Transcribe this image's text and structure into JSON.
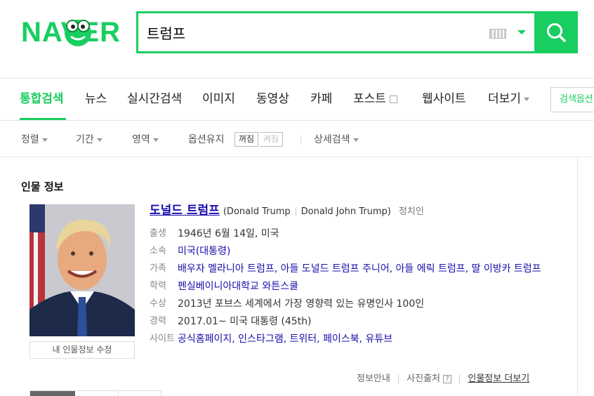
{
  "logo": {
    "text": "NAVER"
  },
  "search": {
    "query": "트럼프"
  },
  "tabs": {
    "items": [
      {
        "label": "통합검색",
        "active": true
      },
      {
        "label": "뉴스"
      },
      {
        "label": "실시간검색"
      },
      {
        "label": "이미지"
      },
      {
        "label": "동영상"
      },
      {
        "label": "카페"
      },
      {
        "label": "포스트"
      },
      {
        "label": "웹사이트"
      },
      {
        "label": "더보기"
      }
    ],
    "options_label": "검색옵션"
  },
  "filters": {
    "sort": "정렬",
    "period": "기간",
    "area": "영역",
    "keep_option": "옵션유지",
    "toggle_on": "꺼짐",
    "toggle_off": "켜짐",
    "detail": "상세검색"
  },
  "person": {
    "section_title": "인물 정보",
    "name": "도널드 트럼프",
    "name_en_open": "(Donald Trump",
    "name_en_full": "Donald John Trump)",
    "occupation": "정치인",
    "edit_label": "내 인물정보 수정",
    "rows": [
      {
        "label": "출생",
        "value": "1946년 6월 14일, 미국"
      },
      {
        "label": "소속",
        "value": "미국(대통령)"
      },
      {
        "label": "가족",
        "value": "배우자 멜라니아 트럼프, 아들 도널드 트럼프 주니어, 아들 에릭 트럼프, 딸 이방카 트럼프"
      },
      {
        "label": "학력",
        "value": "펜실베이니아대학교 와튼스쿨"
      },
      {
        "label": "수상",
        "value": "2013년 포브스 세계에서 가장 영향력 있는 유명인사 100인"
      },
      {
        "label": "경력",
        "value": "2017.01~ 미국 대통령 (45th)"
      },
      {
        "label": "사이트",
        "value": "공식홈페이지, 인스타그램, 트위터, 페이스북, 유튜브"
      }
    ]
  },
  "footer": {
    "info_guide": "정보안내",
    "photo_source": "사진출처",
    "more_info": "인물정보 더보기"
  },
  "colors": {
    "brand": "#19ce60",
    "link": "#1a0dab"
  }
}
